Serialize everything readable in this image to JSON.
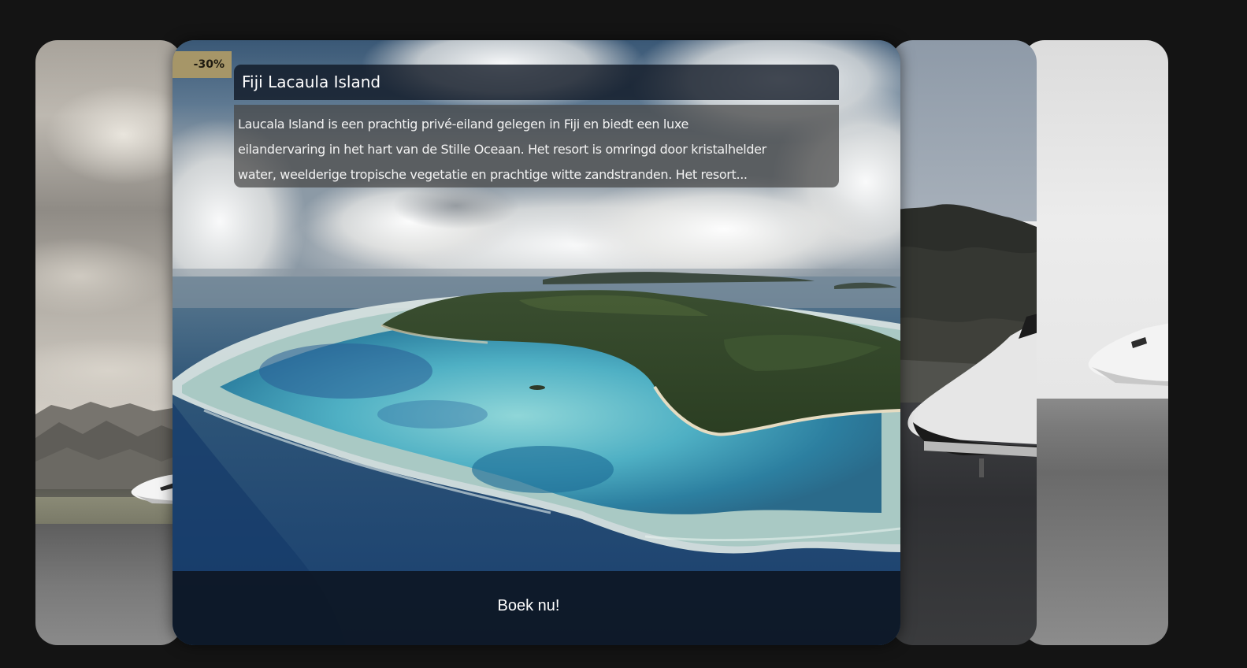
{
  "carousel": {
    "featured": {
      "badge": "-30%",
      "title": "Fiji Lacaula Island",
      "description_lines": [
        "Laucala Island is een prachtig privé-eiland gelegen in Fiji en biedt een luxe",
        "eilandervaring in het hart van de Stille Oceaan. Het resort is omringd door kristalhelder",
        "water, weelderige tropische vegetatie en prachtige witte zandstranden. Het resort..."
      ],
      "cta_label": "Boek nu!"
    },
    "side_cards": [
      {
        "scene": "private-jet-runway-mountains"
      },
      {
        "scene": "private-jet-tarmac-forest"
      },
      {
        "scene": "private-jet-runway-overcast"
      }
    ]
  },
  "colors": {
    "page_background": "#141414",
    "badge_background": "#a69668",
    "title_bar": "#0e1622",
    "description_panel": "#464646",
    "cta_bar": "#0c1420"
  }
}
